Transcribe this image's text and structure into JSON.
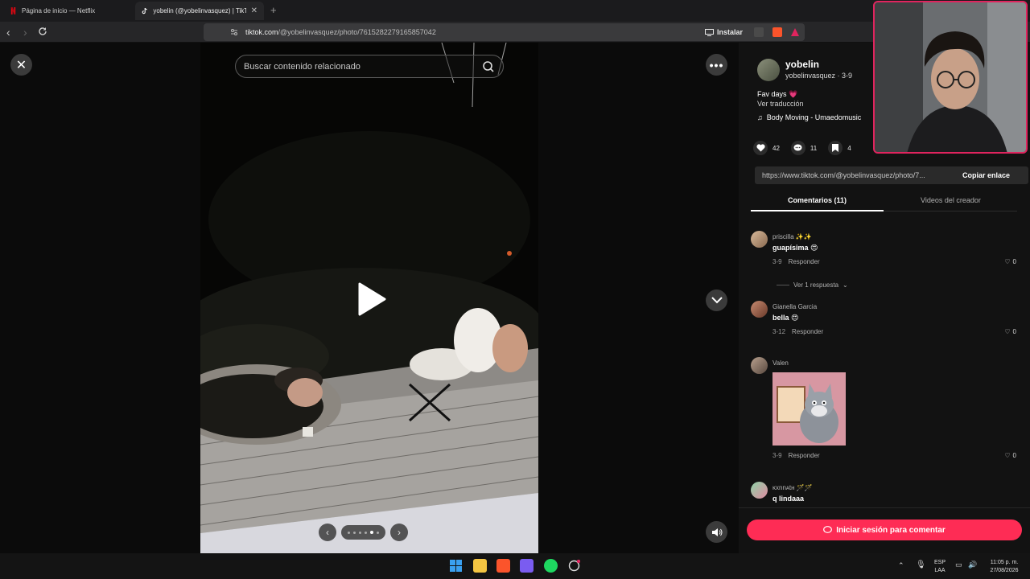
{
  "browser": {
    "tabs": [
      {
        "title": "Página de inicio — Netflix"
      },
      {
        "title": "yobelin (@yobelinvasquez) | TikT..."
      }
    ],
    "url_domain": "tiktok.com",
    "url_path": "/@yobelinvasquez/photo/7615282279165857042",
    "install_label": "Instalar"
  },
  "viewer": {
    "search_placeholder": "Buscar contenido relacionado",
    "slide_count": 6,
    "active_slide": 5
  },
  "post": {
    "author_name": "yobelin",
    "author_meta": "yobelinvasquez · 3-9",
    "caption": "Fav days 💗",
    "translate": "Ver traducción",
    "music": "Body Moving - Umaedomusic",
    "likes": "42",
    "comments": "11",
    "saves": "4",
    "share_url": "https://www.tiktok.com/@yobelinvasquez/photo/7...",
    "copy_label": "Copiar enlace"
  },
  "tabs": {
    "comments": "Comentarios (11)",
    "videos": "Videos del creador"
  },
  "comments": [
    {
      "user": "priscilla ✨✨",
      "text": "guapísima 😍",
      "date": "3-9",
      "reply": "Responder",
      "likes": "0",
      "view_replies": "Ver 1 respuesta"
    },
    {
      "user": "Gianella Garcia",
      "text": "bella 😍",
      "date": "3-12",
      "reply": "Responder",
      "likes": "0"
    },
    {
      "user": "Valen",
      "text": "",
      "date": "3-9",
      "reply": "Responder",
      "likes": "0"
    },
    {
      "user": "ĸxnnᴀtʜ 🪄🪄",
      "text": "q lindaaa",
      "date": "",
      "reply": "",
      "likes": ""
    }
  ],
  "login": {
    "label": "Iniciar sesión para comentar"
  },
  "taskbar": {
    "lang": "ESP",
    "lang2": "LAA",
    "time": "11:05 p. m.",
    "date": "27/08/2026"
  },
  "colors": {
    "accent": "#fe2c55",
    "panel_bg": "#121212",
    "webcam_border": "#e0245e"
  }
}
